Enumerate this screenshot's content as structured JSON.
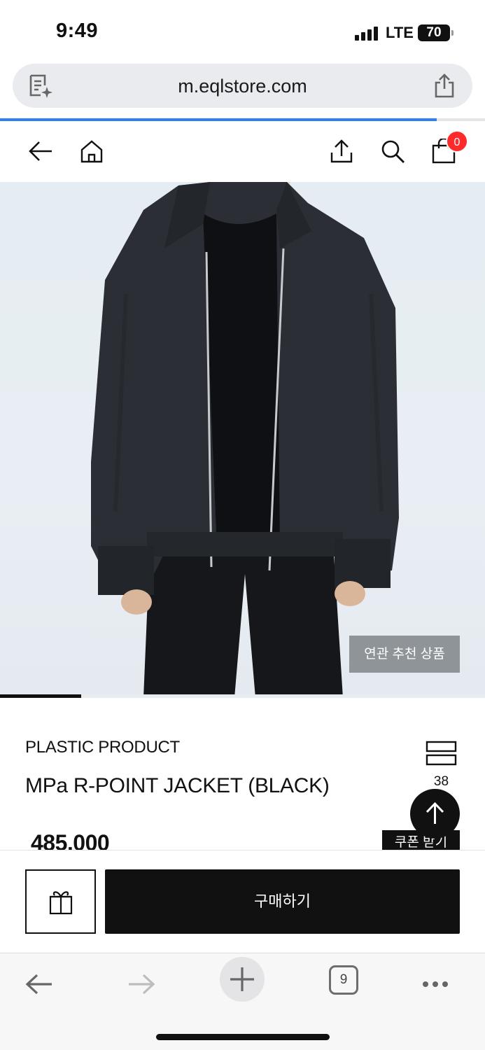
{
  "status_bar": {
    "time": "9:49",
    "carrier": "LTE",
    "battery": "70"
  },
  "browser": {
    "url": "m.eqlstore.com",
    "load_progress": 0.9
  },
  "header": {
    "cart_count": "0"
  },
  "gallery": {
    "related_label": "연관 추천 상품",
    "slide_progress": 0.167
  },
  "product": {
    "brand": "PLASTIC PRODUCT",
    "name": "MPa R-POINT JACKET (BLACK)",
    "likes": "38",
    "price": "485,000",
    "coupon_label": "쿠폰 받기"
  },
  "purchase": {
    "buy_label": "구매하기"
  },
  "toolbar": {
    "tab_count": "9"
  },
  "colors": {
    "accent": "#2f7ef5",
    "badge": "#ff2a2a",
    "primary": "#111111"
  }
}
